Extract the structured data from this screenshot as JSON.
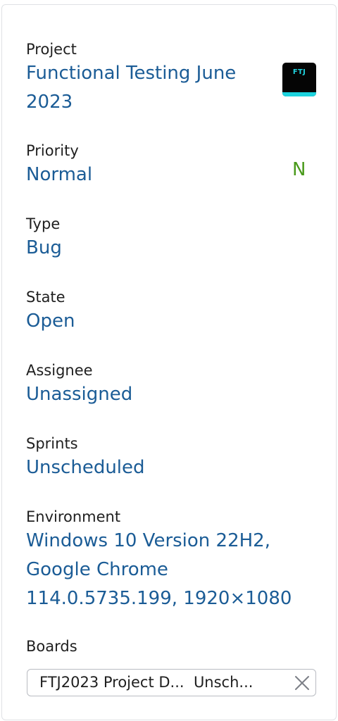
{
  "project": {
    "label": "Project",
    "value": "Functional Testing June 2023",
    "badge_text": "FTJ",
    "badge_color": "#050505",
    "badge_accent": "#1dd3de"
  },
  "priority": {
    "label": "Priority",
    "value": "Normal",
    "short": "N",
    "short_color": "#4a9a1c"
  },
  "type": {
    "label": "Type",
    "value": "Bug"
  },
  "state": {
    "label": "State",
    "value": "Open"
  },
  "assignee": {
    "label": "Assignee",
    "value": "Unassigned"
  },
  "sprints": {
    "label": "Sprints",
    "value": "Unscheduled"
  },
  "environment": {
    "label": "Environment",
    "value": "Windows 10 Version 22H2, Google Chrome 114.0.5735.199, 1920×1080"
  },
  "boards": {
    "label": "Boards",
    "tag_board": "FTJ2023 Project D...",
    "tag_column": "Unsch...",
    "remove_icon": "close-icon"
  },
  "colors": {
    "link": "#1b5c96",
    "label": "#1f1f1f",
    "border": "#dfe1e5"
  }
}
